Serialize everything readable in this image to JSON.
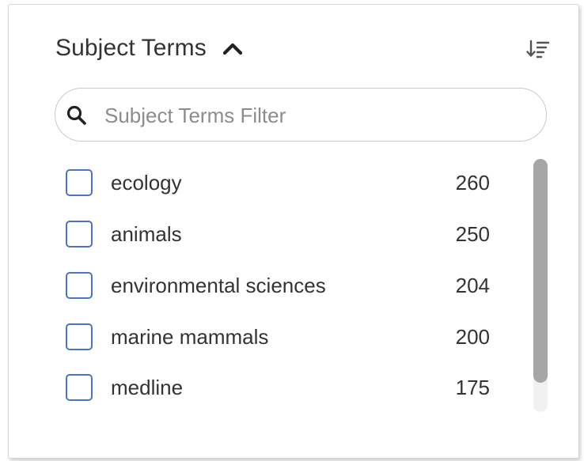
{
  "facet": {
    "title": "Subject Terms",
    "expanded": true,
    "sort_icon": "sort-descending-icon",
    "collapse_icon": "chevron-up-icon"
  },
  "search": {
    "icon": "search-icon",
    "placeholder": "Subject Terms Filter",
    "value": ""
  },
  "terms": [
    {
      "label": "ecology",
      "count": "260",
      "checked": false
    },
    {
      "label": "animals",
      "count": "250",
      "checked": false
    },
    {
      "label": "environmental sciences",
      "count": "204",
      "checked": false
    },
    {
      "label": "marine mammals",
      "count": "200",
      "checked": false
    },
    {
      "label": "medline",
      "count": "175",
      "checked": false
    }
  ],
  "colors": {
    "checkbox_border": "#4a74c9",
    "text": "#333333",
    "placeholder": "#8c8c8c",
    "scroll_thumb": "#a6a6a6"
  }
}
